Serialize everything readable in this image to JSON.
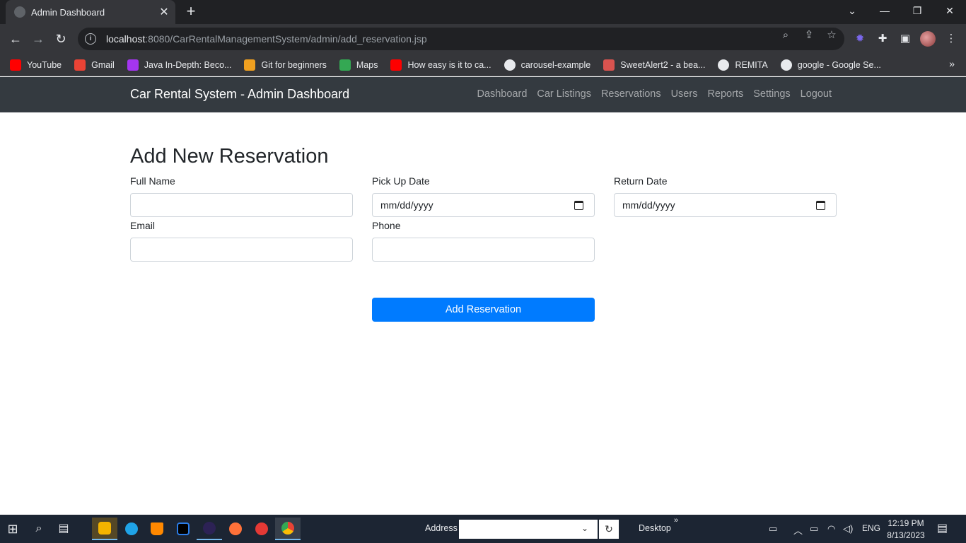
{
  "browser": {
    "tab_title": "Admin Dashboard",
    "url_host": "localhost",
    "url_rest": ":8080/CarRentalManagementSystem/admin/add_reservation.jsp"
  },
  "bookmarks": [
    {
      "label": "YouTube",
      "icon": "youtube-icon",
      "color": "#ff0000"
    },
    {
      "label": "Gmail",
      "icon": "gmail-icon",
      "color": "#ea4335"
    },
    {
      "label": "Java In-Depth: Beco...",
      "icon": "udemy-icon",
      "color": "#a435f0"
    },
    {
      "label": "Git for beginners",
      "icon": "git-icon",
      "color": "#f0a020"
    },
    {
      "label": "Maps",
      "icon": "maps-icon",
      "color": "#34a853"
    },
    {
      "label": "How easy is it to ca...",
      "icon": "youtube-icon",
      "color": "#ff0000"
    },
    {
      "label": "carousel-example",
      "icon": "globe-icon",
      "color": "#5f6368"
    },
    {
      "label": "SweetAlert2 - a bea...",
      "icon": "sweetalert-icon",
      "color": "#d9534f"
    },
    {
      "label": "REMITA",
      "icon": "globe-icon",
      "color": "#5f6368"
    },
    {
      "label": "google - Google Se...",
      "icon": "globe-icon",
      "color": "#5f6368"
    }
  ],
  "nav": {
    "brand": "Car Rental System - Admin Dashboard",
    "links": [
      "Dashboard",
      "Car Listings",
      "Reservations",
      "Users",
      "Reports",
      "Settings",
      "Logout"
    ]
  },
  "form": {
    "title": "Add New Reservation",
    "full_name_label": "Full Name",
    "full_name_value": "",
    "pickup_label": "Pick Up Date",
    "pickup_placeholder": "mm/dd/yyyy",
    "return_label": "Return Date",
    "return_placeholder": "mm/dd/yyyy",
    "email_label": "Email",
    "email_value": "",
    "phone_label": "Phone",
    "phone_value": "",
    "submit_label": "Add Reservation"
  },
  "taskbar": {
    "address_label": "Address",
    "desktop_label": "Desktop",
    "lang": "ENG",
    "time": "12:19 PM",
    "date": "8/13/2023"
  },
  "colors": {
    "navbar_bg": "#343a40",
    "primary": "#007bff"
  }
}
